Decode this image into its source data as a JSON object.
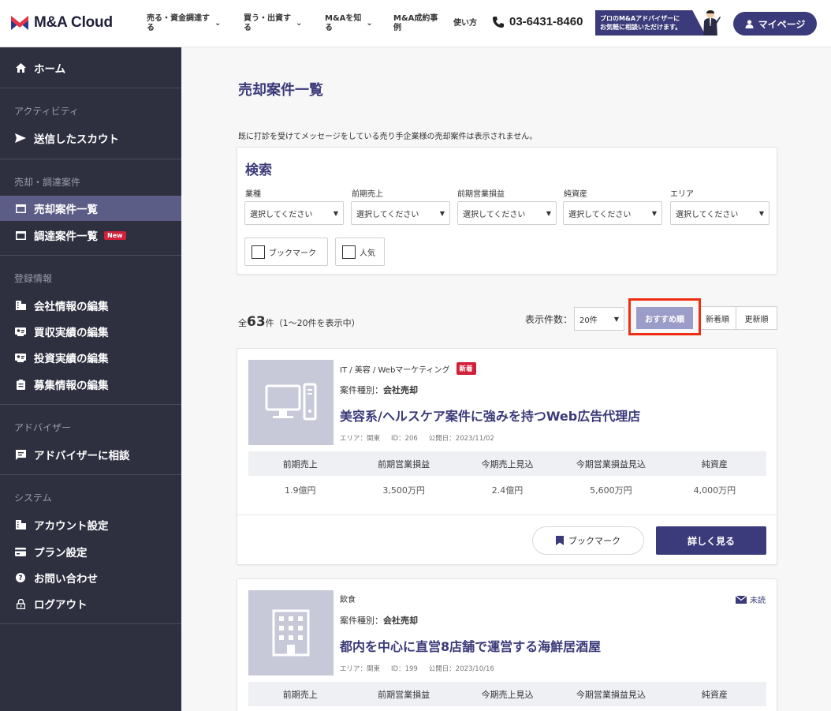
{
  "header": {
    "logo_text": "M&A Cloud",
    "nav": [
      {
        "line1": "売る・資金調達す",
        "line2": "る"
      },
      {
        "line1": "買う・出資す",
        "line2": "る"
      },
      {
        "line1": "M&Aを知",
        "line2": "る"
      },
      {
        "line1": "M&A成約事",
        "line2": "例"
      },
      {
        "line1": "使い方",
        "line2": ""
      }
    ],
    "phone": "03-6431-8460",
    "banner_line1": "プロのM&Aアドバイザーに",
    "banner_line2": "お気軽に相談いただけます。",
    "mypage": "マイページ"
  },
  "sidebar": {
    "home": "ホーム",
    "sections": {
      "activity": "アクティビティ",
      "deals": "売却・調達案件",
      "registration": "登録情報",
      "advisor": "アドバイザー",
      "system": "システム"
    },
    "items": {
      "sent_scout": "送信したスカウト",
      "sell_list": "売却案件一覧",
      "fund_list": "調達案件一覧",
      "new_badge": "New",
      "company_edit": "会社情報の編集",
      "acquisition_edit": "買収実績の編集",
      "investment_edit": "投資実績の編集",
      "recruit_edit": "募集情報の編集",
      "consult": "アドバイザーに相談",
      "account": "アカウント設定",
      "plan": "プラン設定",
      "contact": "お問い合わせ",
      "logout": "ログアウト"
    }
  },
  "main": {
    "title": "売却案件一覧",
    "notice": "既に打診を受けてメッセージをしている売り手企業様の売却案件は表示されません。",
    "search": {
      "title": "検索",
      "fields": [
        {
          "label": "業種",
          "placeholder": "選択してください"
        },
        {
          "label": "前期売上",
          "placeholder": "選択してください"
        },
        {
          "label": "前期営業損益",
          "placeholder": "選択してください"
        },
        {
          "label": "純資産",
          "placeholder": "選択してください"
        },
        {
          "label": "エリア",
          "placeholder": "選択してください"
        }
      ],
      "bookmark": "ブックマーク",
      "popular": "人気"
    },
    "results": {
      "prefix": "全",
      "total": "63",
      "unit": "件",
      "range": "（1〜20件を表示中）",
      "display_label": "表示件数：",
      "per_page": "20件",
      "sort": [
        "おすすめ順",
        "新着順",
        "更新順"
      ]
    },
    "fin_headers": [
      "前期売上",
      "前期営業損益",
      "今期売上見込",
      "今期営業損益見込",
      "純資産"
    ],
    "cards": [
      {
        "category": "IT / 美容 / Webマーケティング",
        "badge": "新着",
        "type_label": "案件種別：",
        "type_value": "会社売却",
        "title": "美容系/ヘルスケア案件に強みを持つWeb広告代理店",
        "area": "エリア：関東",
        "id": "ID：206",
        "published": "公開日：2023/11/02",
        "values": [
          "1.9億円",
          "3,500万円",
          "2.4億円",
          "5,600万円",
          "4,000万円"
        ],
        "bookmark": "ブックマーク",
        "detail": "詳しく見る"
      },
      {
        "category": "飲食",
        "unread": "未読",
        "type_label": "案件種別：",
        "type_value": "会社売却",
        "title": "都内を中心に直営8店舗で運営する海鮮居酒屋",
        "area": "エリア：関東",
        "id": "ID：199",
        "published": "公開日：2023/10/16"
      }
    ]
  }
}
